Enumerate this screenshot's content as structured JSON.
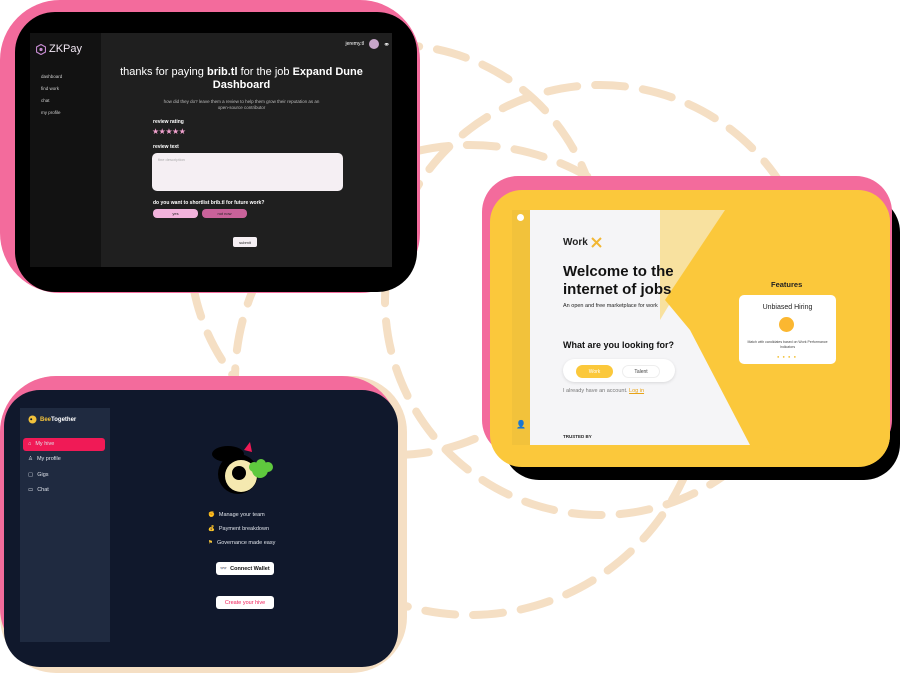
{
  "zkpay": {
    "brand": "ZKPay",
    "nav": [
      "dashboard",
      "find work",
      "chat",
      "my profile"
    ],
    "user": "jeremy.tl",
    "title_pre": "thanks for paying",
    "title_name": "brib.tl",
    "title_mid": "for the job",
    "title_job": "Expand Dune Dashboard",
    "subtitle": "how did they do? leave them a review to help them grow their reputation as an open-source contributor",
    "rating_label": "review rating",
    "stars": "★★★★★",
    "review_label": "review text",
    "review_placeholder": "fine description",
    "shortlist_question": "do you want to shortlist brib.tl for future work?",
    "yes": "yes",
    "no": "not now",
    "submit": "submit"
  },
  "work": {
    "logo": "Work",
    "heading_line1": "Welcome to the",
    "heading_line2": "internet of jobs",
    "tagline": "An open and free marketplace for work",
    "question": "What are you looking for?",
    "option_work": "Work",
    "option_talent": "Talent",
    "already": "I already have an account.",
    "login": "Log in",
    "trusted": "TRUSTED BY",
    "features_title": "Features",
    "feature_card_title": "Unbiased Hiring",
    "feature_card_desc": "Match with candidates based on Work Performance Indicators",
    "accent": "#fbc83b"
  },
  "bee": {
    "brand_a": "Bee",
    "brand_b": "Together",
    "nav": [
      "My hive",
      "My profile",
      "Gigs",
      "Chat"
    ],
    "features": [
      "Manage your team",
      "Payment breakdown",
      "Governance made easy"
    ],
    "connect_wallet": "Connect Wallet",
    "create_hive": "Create your hive",
    "accent": "#f01a56"
  }
}
